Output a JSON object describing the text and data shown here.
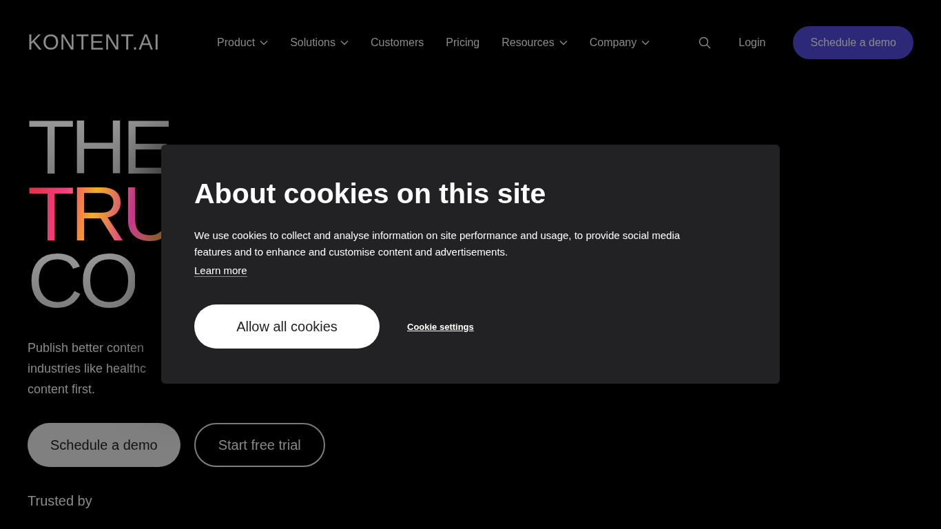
{
  "header": {
    "logo": "KONTENT.AI",
    "nav": [
      {
        "label": "Product",
        "has_menu": true
      },
      {
        "label": "Solutions",
        "has_menu": true
      },
      {
        "label": "Customers",
        "has_menu": false
      },
      {
        "label": "Pricing",
        "has_menu": false
      },
      {
        "label": "Resources",
        "has_menu": true
      },
      {
        "label": "Company",
        "has_menu": true
      }
    ],
    "login": "Login",
    "cta": "Schedule a demo"
  },
  "hero": {
    "headline": [
      {
        "text": "THE",
        "kind": "plain"
      },
      {
        "text": "TRU",
        "kind": "colorful"
      },
      {
        "text": "CO",
        "kind": "plain"
      }
    ],
    "paragraph_lines": [
      "Publish better conten",
      "industries like healthc",
      "content first."
    ],
    "buttons": [
      {
        "label": "Schedule a demo",
        "kind": "filled"
      },
      {
        "label": "Start free trial",
        "kind": "outline"
      }
    ],
    "trusted_by": "Trusted by"
  },
  "cookie_dialog": {
    "title": "About cookies on this site",
    "body": "We use cookies to collect and analyse information on site performance and usage, to provide social media features and to enhance and customise content and advertisements.",
    "learn_more": "Learn more",
    "accept": "Allow all cookies",
    "settings": "Cookie settings"
  }
}
